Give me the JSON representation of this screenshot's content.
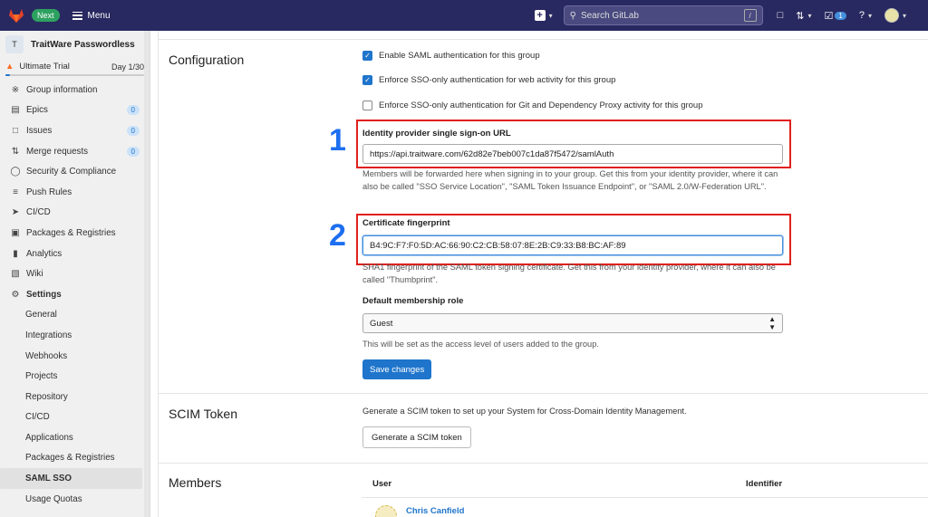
{
  "topbar": {
    "next_badge": "Next",
    "menu_label": "Menu",
    "search_placeholder": "Search GitLab",
    "search_shortcut": "/",
    "todo_count": "1"
  },
  "sidebar": {
    "group_initial": "T",
    "group_name": "TraitWare Passwordless",
    "trial_label": "Ultimate Trial",
    "trial_day": "Day 1/30",
    "trial_progress": 0.033,
    "items": [
      {
        "label": "Group information",
        "icon": "info"
      },
      {
        "label": "Epics",
        "icon": "epic",
        "count": "0"
      },
      {
        "label": "Issues",
        "icon": "issues",
        "count": "0"
      },
      {
        "label": "Merge requests",
        "icon": "merge",
        "count": "0"
      },
      {
        "label": "Security & Compliance",
        "icon": "shield"
      },
      {
        "label": "Push Rules",
        "icon": "push"
      },
      {
        "label": "CI/CD",
        "icon": "rocket"
      },
      {
        "label": "Packages & Registries",
        "icon": "package"
      },
      {
        "label": "Analytics",
        "icon": "chart"
      },
      {
        "label": "Wiki",
        "icon": "book"
      },
      {
        "label": "Settings",
        "icon": "gear"
      }
    ],
    "settings_sub": [
      "General",
      "Integrations",
      "Webhooks",
      "Projects",
      "Repository",
      "CI/CD",
      "Applications",
      "Packages & Registries",
      "SAML SSO",
      "Usage Quotas"
    ]
  },
  "configuration": {
    "title": "Configuration",
    "checkboxes": [
      {
        "label": "Enable SAML authentication for this group",
        "checked": true
      },
      {
        "label": "Enforce SSO-only authentication for web activity for this group",
        "checked": true
      },
      {
        "label": "Enforce SSO-only authentication for Git and Dependency Proxy activity for this group",
        "checked": false
      }
    ],
    "sso_url_label": "Identity provider single sign-on URL",
    "sso_url_value": "https://api.traitware.com/62d82e7beb007c1da87f5472/samlAuth",
    "sso_url_help": "Members will be forwarded here when signing in to your group. Get this from your identity provider, where it can also be called \"SSO Service Location\", \"SAML Token Issuance Endpoint\", or \"SAML 2.0/W-Federation URL\".",
    "fingerprint_label": "Certificate fingerprint",
    "fingerprint_value": "B4:9C:F7:F0:5D:AC:66:90:C2:CB:58:07:8E:2B:C9:33:B8:BC:AF:89",
    "fingerprint_help": "SHA1 fingerprint of the SAML token signing certificate. Get this from your identity provider, where it can also be called \"Thumbprint\".",
    "role_label": "Default membership role",
    "role_value": "Guest",
    "role_help": "This will be set as the access level of users added to the group.",
    "save_label": "Save changes"
  },
  "annotations": {
    "one": "1",
    "two": "2"
  },
  "scim": {
    "title": "SCIM Token",
    "description": "Generate a SCIM token to set up your System for Cross-Domain Identity Management.",
    "button_label": "Generate a SCIM token"
  },
  "members": {
    "title": "Members",
    "col_user": "User",
    "col_identifier": "Identifier",
    "rows": [
      {
        "name": "Chris Canfield"
      }
    ]
  },
  "colors": {
    "topbar": "#292961",
    "accent": "#1f75cb",
    "annotation_box": "#e0201b",
    "annotation_number": "#1d6ff0"
  }
}
